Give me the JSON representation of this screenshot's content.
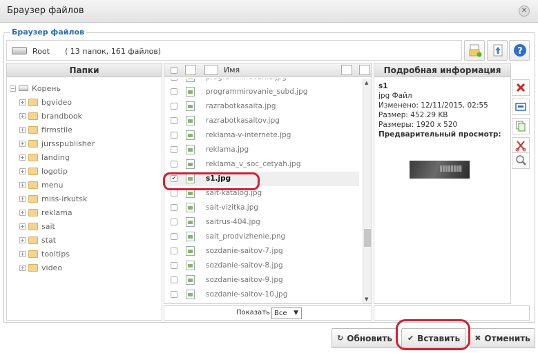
{
  "window": {
    "title": "Браузер файлов"
  },
  "fieldset": {
    "legend": "Браузер файлов"
  },
  "path": {
    "root": "Root",
    "summary": "( 13 папок, 161 файлов)"
  },
  "folders_panel": {
    "header": "Папки",
    "root_label": "Корень",
    "items": [
      "bgvideo",
      "brandbook",
      "firmstile",
      "jursspublisher",
      "landing",
      "logotip",
      "menu",
      "miss-irkutsk",
      "reklama",
      "sait",
      "stat",
      "tooltips",
      "video"
    ]
  },
  "files_panel": {
    "column_name": "Имя",
    "files": [
      {
        "name": "programmirovanie.jpg",
        "checked": false
      },
      {
        "name": "programmirovanie_subd.jpg",
        "checked": false
      },
      {
        "name": "razrabotkasaita.jpg",
        "checked": false
      },
      {
        "name": "razrabotkasaitov.jpg",
        "checked": false
      },
      {
        "name": "reklama-v-internete.jpg",
        "checked": false
      },
      {
        "name": "reklama.jpg",
        "checked": false
      },
      {
        "name": "reklama_v_soc_cetyah.jpg",
        "checked": false
      },
      {
        "name": "s1.jpg",
        "checked": true
      },
      {
        "name": "sait-katalog.jpg",
        "checked": false
      },
      {
        "name": "sait-vizitka.jpg",
        "checked": false
      },
      {
        "name": "saitrus-404.jpg",
        "checked": false
      },
      {
        "name": "sait_prodvizhenie.png",
        "checked": false
      },
      {
        "name": "sozdanie-saitov-7.jpg",
        "checked": false
      },
      {
        "name": "sozdanie-saitov-8.jpg",
        "checked": false
      },
      {
        "name": "sozdanie-saitov-9.jpg",
        "checked": false
      },
      {
        "name": "sozdanie-saitov-10.jpg",
        "checked": false
      }
    ],
    "show_label": "Показать",
    "show_value": "Все"
  },
  "details_panel": {
    "header": "Подробная информация",
    "name": "s1",
    "type": "jpg Файл",
    "modified": "Изменено: 12/11/2015, 02:55",
    "size": "Размер: 452.29 KB",
    "dimensions": "Размеры: 1920 x 520",
    "preview_label": "Предварительный просмотр:"
  },
  "buttons": {
    "refresh": "Обновить",
    "insert": "Вставить",
    "cancel": "Отменить"
  },
  "colors": {
    "legend": "#2a6cb0",
    "highlight": "#cc2233",
    "delete": "#d22222"
  }
}
